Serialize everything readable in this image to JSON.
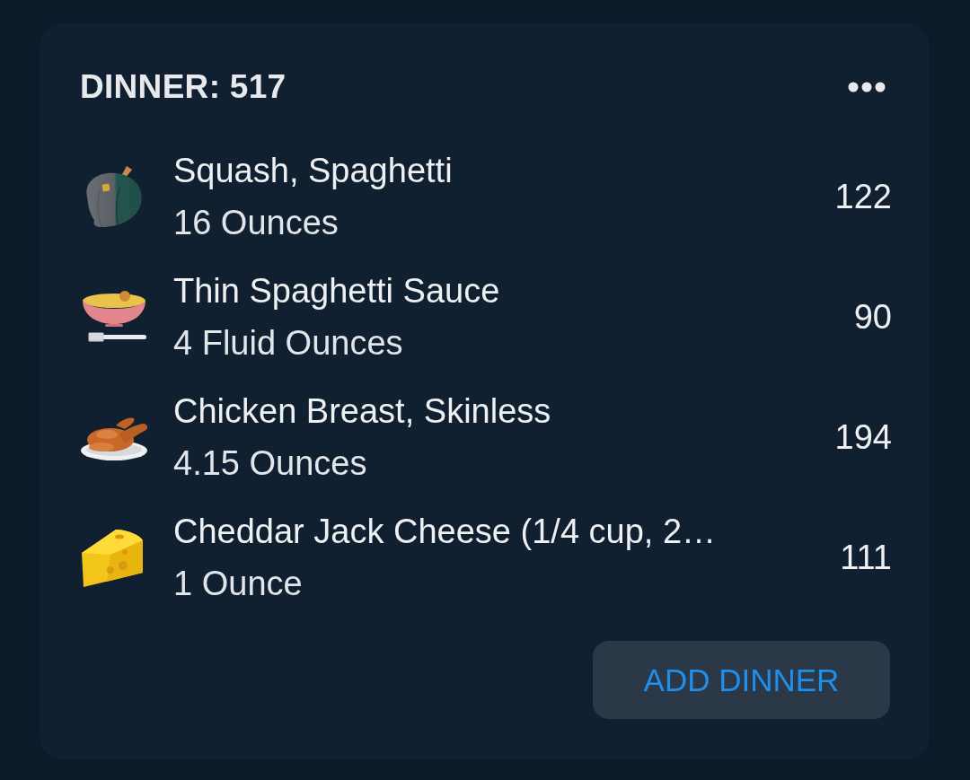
{
  "header": {
    "title": "DINNER: 517"
  },
  "entries": [
    {
      "name": "Squash, Spaghetti",
      "serving": "16 Ounces",
      "calories": "122"
    },
    {
      "name": "Thin Spaghetti Sauce",
      "serving": "4 Fluid Ounces",
      "calories": "90"
    },
    {
      "name": "Chicken Breast, Skinless",
      "serving": "4.15 Ounces",
      "calories": "194"
    },
    {
      "name": "Cheddar Jack Cheese (1/4 cup, 2…",
      "serving": "1 Ounce",
      "calories": "111"
    }
  ],
  "add_button": {
    "label": "ADD DINNER"
  }
}
